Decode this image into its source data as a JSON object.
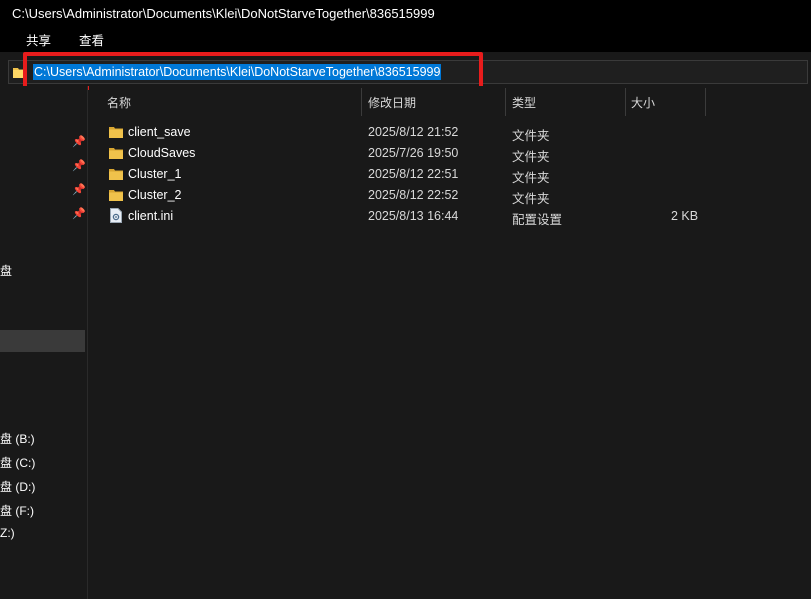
{
  "window": {
    "title": "C:\\Users\\Administrator\\Documents\\Klei\\DoNotStarveTogether\\836515999"
  },
  "ribbon": {
    "tabs": [
      "共享",
      "查看"
    ]
  },
  "address": {
    "path": "C:\\Users\\Administrator\\Documents\\Klei\\DoNotStarveTogether\\836515999"
  },
  "sidebar": {
    "disk_label": "盘",
    "drives": [
      "盘 (B:)",
      "盘 (C:)",
      "盘 (D:)",
      "盘 (F:)",
      "Z:)"
    ]
  },
  "columns": {
    "name": "名称",
    "modified": "修改日期",
    "type": "类型",
    "size": "大小"
  },
  "files": [
    {
      "name": "client_save",
      "modified": "2025/8/12 21:52",
      "type": "文件夹",
      "size": "",
      "icon": "folder-icon"
    },
    {
      "name": "CloudSaves",
      "modified": "2025/7/26 19:50",
      "type": "文件夹",
      "size": "",
      "icon": "folder-icon"
    },
    {
      "name": "Cluster_1",
      "modified": "2025/8/12 22:51",
      "type": "文件夹",
      "size": "",
      "icon": "folder-icon"
    },
    {
      "name": "Cluster_2",
      "modified": "2025/8/12 22:52",
      "type": "文件夹",
      "size": "",
      "icon": "folder-icon"
    },
    {
      "name": "client.ini",
      "modified": "2025/8/13 16:44",
      "type": "配置设置",
      "size": "2 KB",
      "icon": "settings-file-icon"
    }
  ],
  "colors": {
    "selection": "#0078d7",
    "highlight_box": "#e81c1c",
    "folder": "#f0c24b"
  }
}
